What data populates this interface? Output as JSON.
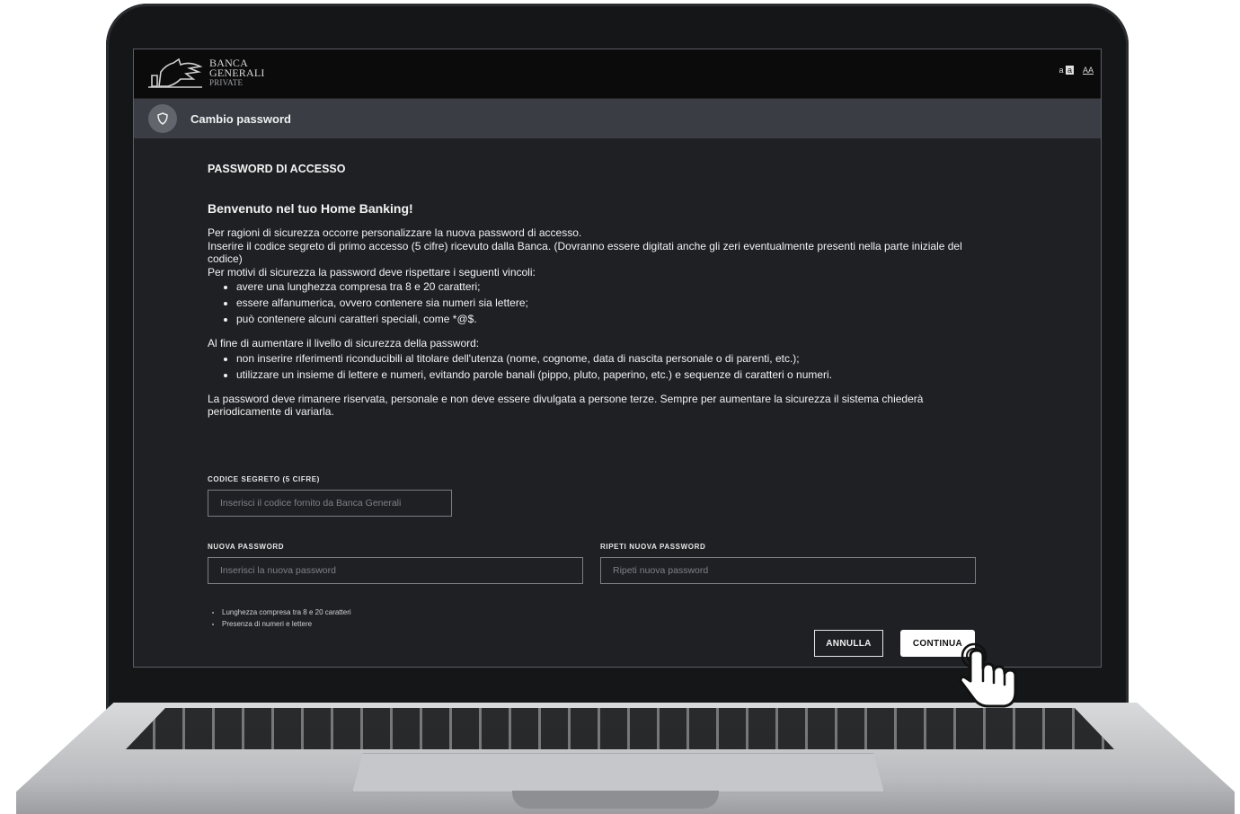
{
  "brand": {
    "line1": "BANCA",
    "line2": "GENERALI",
    "line3": "PRIVATE"
  },
  "font_controls": {
    "small": "a",
    "small_box": "a",
    "large": "AA"
  },
  "titlebar": {
    "title": "Cambio password"
  },
  "content": {
    "section_title": "PASSWORD DI ACCESSO",
    "welcome": "Benvenuto nel tuo Home Banking!",
    "intro": [
      "Per ragioni di sicurezza occorre personalizzare la nuova password di accesso.",
      "Inserire il codice segreto di primo accesso (5 cifre) ricevuto dalla Banca. (Dovranno essere digitati anche gli zeri eventualmente presenti nella parte iniziale del codice)",
      "Per motivi di sicurezza la password deve rispettare i seguenti vincoli:"
    ],
    "constraints": [
      "avere una lunghezza compresa tra 8 e 20 caratteri;",
      "essere alfanumerica, ovvero contenere sia numeri sia lettere;",
      "può contenere alcuni caratteri speciali, come *@$."
    ],
    "security_intro": "Al fine di aumentare il livello di sicurezza della password:",
    "security_tips": [
      "non inserire riferimenti riconducibili al titolare dell'utenza (nome, cognome, data di nascita personale o di parenti, etc.);",
      "utilizzare un insieme di lettere e numeri, evitando parole banali (pippo, pluto, paperino, etc.) e sequenze di caratteri o numeri."
    ],
    "closing": "La password deve rimanere riservata, personale e non deve essere divulgata a persone terze. Sempre per aumentare la sicurezza il sistema chiederà periodicamente di variarla."
  },
  "form": {
    "code_label": "CODICE SEGRETO (5 CIFRE)",
    "code_placeholder": "Inserisci il codice fornito da Banca Generali",
    "code_value": "",
    "new_password_label": "NUOVA PASSWORD",
    "new_password_placeholder": "Inserisci la nuova password",
    "new_password_value": "",
    "repeat_password_label": "RIPETI NUOVA PASSWORD",
    "repeat_password_placeholder": "Ripeti nuova password",
    "repeat_password_value": "",
    "rules": [
      "Lunghezza compresa tra 8 e 20 caratteri",
      "Presenza di numeri e lettere"
    ]
  },
  "actions": {
    "cancel": "ANNULLA",
    "continue": "CONTINUA"
  },
  "icons": {
    "title_icon": "shield-icon",
    "cursor": "hand-pointer-icon"
  },
  "colors": {
    "background": "#1e2024",
    "header": "#0b0b0c",
    "titlebar": "#3a3e44",
    "text": "#f2f2f2"
  }
}
